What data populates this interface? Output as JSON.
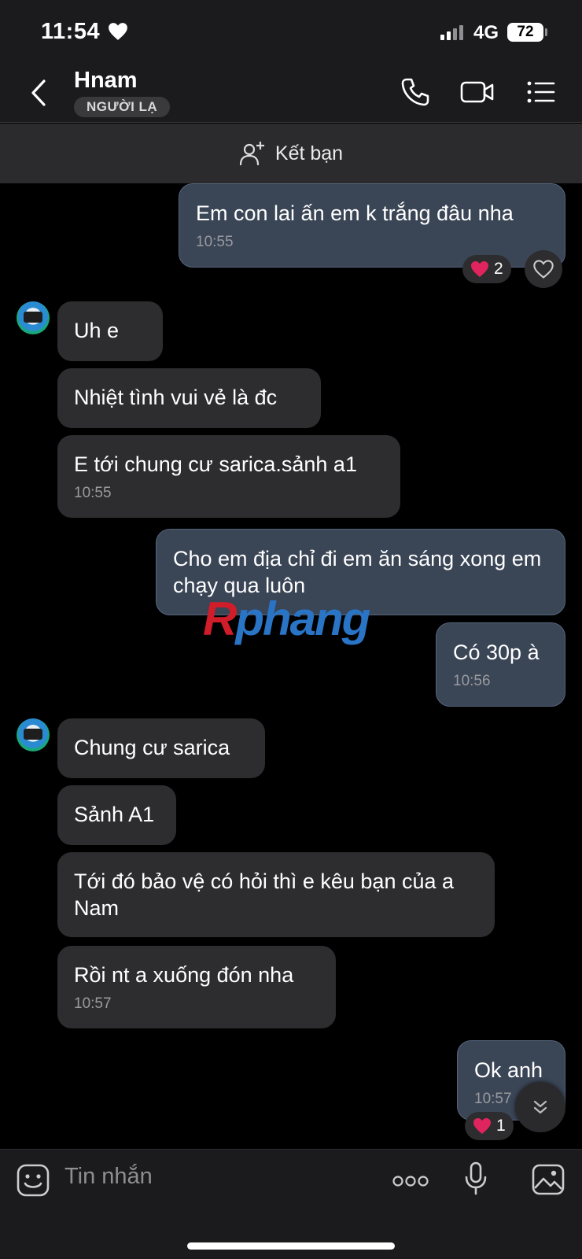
{
  "status_bar": {
    "time": "11:54",
    "network": "4G",
    "battery": "72"
  },
  "header": {
    "name": "Hnam",
    "badge": "NGƯỜI LẠ"
  },
  "friend_bar": {
    "label": "Kết bạn"
  },
  "messages": [
    {
      "text": "Em con lai ấn em k trắng đâu nha",
      "time": "10:55",
      "reaction_count": "2"
    },
    {
      "text": "Uh e"
    },
    {
      "text": "Nhiệt tình vui vẻ là đc"
    },
    {
      "text": "E tới chung cư sarica.sảnh a1",
      "time": "10:55"
    },
    {
      "text": "Cho em địa chỉ đi em ăn sáng xong em chạy qua luôn"
    },
    {
      "text": "Có 30p à",
      "time": "10:56"
    },
    {
      "text": "Chung cư sarica"
    },
    {
      "text": "Sảnh A1"
    },
    {
      "text": "Tới đó bảo vệ có hỏi thì e kêu bạn của a Nam"
    },
    {
      "text": "Rồi nt a xuống đón nha",
      "time": "10:57"
    },
    {
      "text": "Ok anh",
      "time": "10:57",
      "reaction_count": "1"
    }
  ],
  "watermark": {
    "first": "R",
    "rest": "phang"
  },
  "composer": {
    "placeholder": "Tin nhắn"
  },
  "colors": {
    "background": "#000000",
    "bar": "#1b1b1d",
    "incoming": "#2d2d2f",
    "outgoing": "#3a4556",
    "heart": "#e0245e"
  }
}
